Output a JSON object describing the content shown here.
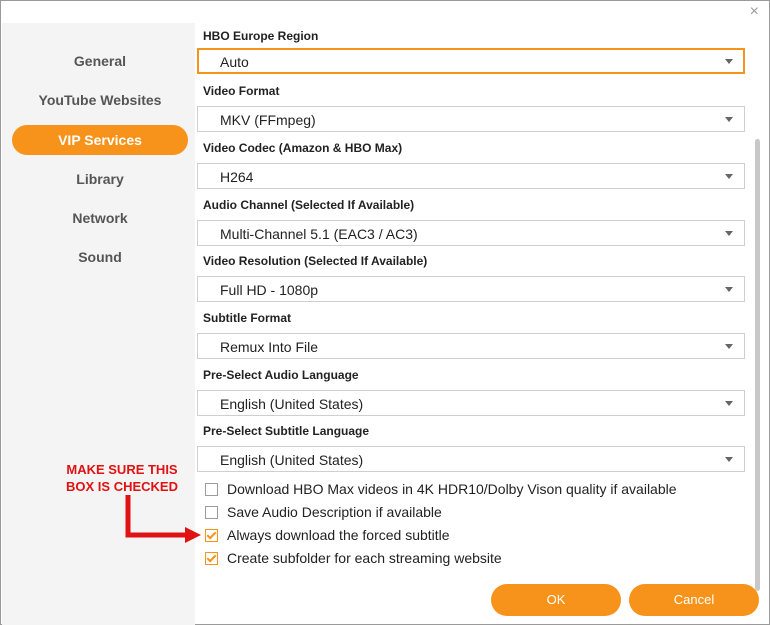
{
  "window": {
    "close_symbol": "×"
  },
  "sidebar": {
    "items": [
      {
        "label": "General"
      },
      {
        "label": "YouTube Websites"
      },
      {
        "label": "VIP Services"
      },
      {
        "label": "Library"
      },
      {
        "label": "Network"
      },
      {
        "label": "Sound"
      }
    ],
    "active_index": 2
  },
  "fields": [
    {
      "label": "HBO Europe Region",
      "value": "Auto"
    },
    {
      "label": "Video Format",
      "value": "MKV (FFmpeg)"
    },
    {
      "label": "Video Codec (Amazon & HBO Max)",
      "value": "H264"
    },
    {
      "label": "Audio Channel (Selected If Available)",
      "value": "Multi-Channel 5.1 (EAC3 / AC3)"
    },
    {
      "label": "Video Resolution (Selected If Available)",
      "value": "Full HD - 1080p"
    },
    {
      "label": "Subtitle Format",
      "value": "Remux Into File"
    },
    {
      "label": "Pre-Select Audio Language",
      "value": "English (United States)"
    },
    {
      "label": "Pre-Select Subtitle Language",
      "value": "English (United States)"
    }
  ],
  "options": [
    {
      "label": "Download HBO Max videos in 4K HDR10/Dolby Vison quality if available",
      "checked": false
    },
    {
      "label": "Save Audio Description if available",
      "checked": false
    },
    {
      "label": "Always download the forced subtitle",
      "checked": true
    },
    {
      "label": "Create subfolder for each streaming website",
      "checked": true
    }
  ],
  "buttons": {
    "ok": "OK",
    "cancel": "Cancel"
  },
  "annotation": {
    "line1": "MAKE SURE THIS",
    "line2": "BOX IS CHECKED"
  },
  "colors": {
    "accent": "#f7931a",
    "annotation": "#e01212"
  }
}
